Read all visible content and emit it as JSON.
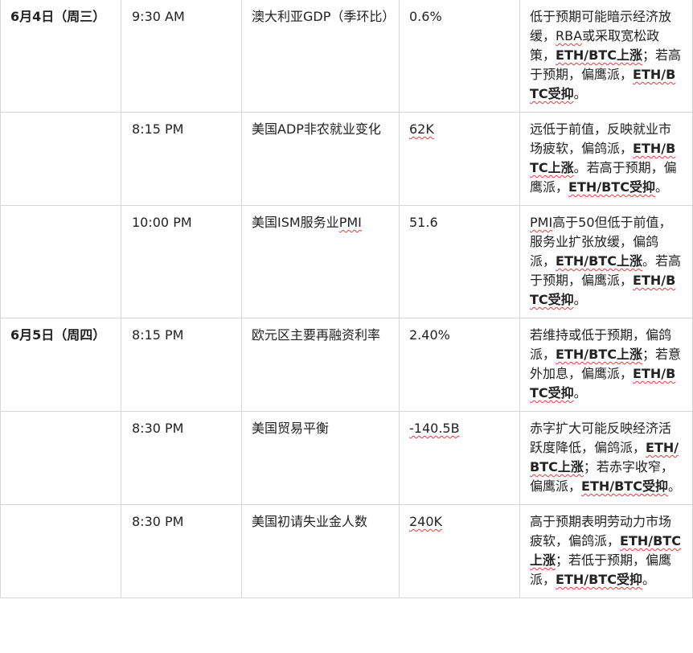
{
  "rows": [
    {
      "date": "6月4日（周三）",
      "time": "9:30 AM",
      "event": [
        {
          "t": "澳大利亚GDP（季环比）"
        }
      ],
      "value": [
        {
          "t": "0.6%"
        }
      ],
      "note": [
        {
          "t": "低于预期可能暗示经济放缓，"
        },
        {
          "t": "RBA",
          "sq": true
        },
        {
          "t": "或采取宽松政策，"
        },
        {
          "t": "ETH/BTC上涨",
          "b": true,
          "sq": true
        },
        {
          "t": "；若高于预期，偏鹰派，"
        },
        {
          "t": "ETH/BTC受抑",
          "b": true,
          "sq": true
        },
        {
          "t": "。"
        }
      ]
    },
    {
      "date": "",
      "time": "8:15 PM",
      "event": [
        {
          "t": "美国ADP非农就业变化"
        }
      ],
      "value": [
        {
          "t": "62K",
          "sq": true
        }
      ],
      "note": [
        {
          "t": "远低于前值，反映就业市场疲软，偏鸽派，"
        },
        {
          "t": "ETH/BTC上涨",
          "b": true,
          "sq": true
        },
        {
          "t": "。若高于预期，偏鹰派，"
        },
        {
          "t": "ETH/BTC受抑",
          "b": true,
          "sq": true
        },
        {
          "t": "。"
        }
      ]
    },
    {
      "date": "",
      "time": "10:00 PM",
      "event": [
        {
          "t": "美国ISM服务业"
        },
        {
          "t": "PMI",
          "sq": true
        }
      ],
      "value": [
        {
          "t": "51.6"
        }
      ],
      "note": [
        {
          "t": "PMI",
          "sq": true
        },
        {
          "t": "高于50但低于前值，服务业扩张放缓，偏鸽派，"
        },
        {
          "t": "ETH/BTC上涨",
          "b": true,
          "sq": true
        },
        {
          "t": "。若高于预期，偏鹰派，"
        },
        {
          "t": "ETH/BTC受抑",
          "b": true,
          "sq": true
        },
        {
          "t": "。"
        }
      ]
    },
    {
      "date": "6月5日（周四）",
      "time": "8:15 PM",
      "event": [
        {
          "t": "欧元区主要再融资利率"
        }
      ],
      "value": [
        {
          "t": "2.40%"
        }
      ],
      "note": [
        {
          "t": "若维持或低于预期，偏鸽派，"
        },
        {
          "t": "ETH/BTC上涨",
          "b": true,
          "sq": true
        },
        {
          "t": "；若意外加息，偏鹰派，"
        },
        {
          "t": "ETH/BTC受抑",
          "b": true,
          "sq": true
        },
        {
          "t": "。"
        }
      ]
    },
    {
      "date": "",
      "time": "8:30 PM",
      "event": [
        {
          "t": "美国贸易平衡"
        }
      ],
      "value": [
        {
          "t": "-140.5B",
          "sq": true
        }
      ],
      "note": [
        {
          "t": "赤字扩大可能反映经济活跃度降低，偏鸽派，"
        },
        {
          "t": "ETH/BTC上涨",
          "b": true,
          "sq": true
        },
        {
          "t": "；若赤字收窄，偏鹰派，"
        },
        {
          "t": "ETH/BTC受抑",
          "b": true,
          "sq": true
        },
        {
          "t": "。"
        }
      ]
    },
    {
      "date": "",
      "time": "8:30 PM",
      "event": [
        {
          "t": "美国初请失业金人数"
        }
      ],
      "value": [
        {
          "t": "240K",
          "sq": true
        }
      ],
      "note": [
        {
          "t": "高于预期表明劳动力市场疲软，偏鸽派，"
        },
        {
          "t": "ETH/BTC上涨",
          "b": true,
          "sq": true
        },
        {
          "t": "；若低于预期，偏鹰派，"
        },
        {
          "t": "ETH/BTC受抑",
          "b": true,
          "sq": true
        },
        {
          "t": "。"
        }
      ]
    }
  ]
}
